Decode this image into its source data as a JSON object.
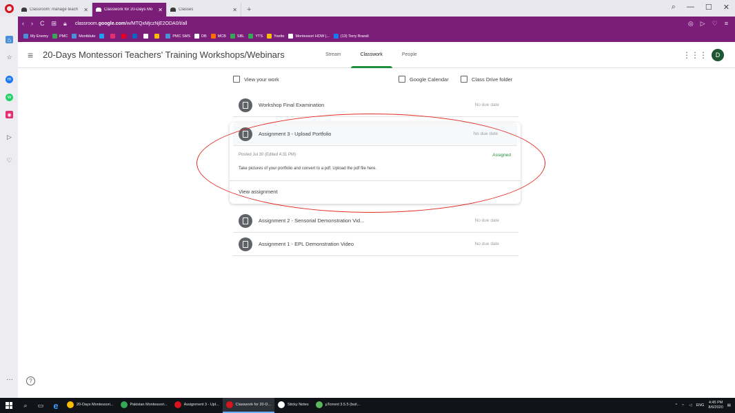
{
  "browser": {
    "tabs": [
      {
        "title": "Classroom: manage teach",
        "active": false
      },
      {
        "title": "Classwork for 20-Days Mo",
        "active": true
      },
      {
        "title": "Classes",
        "active": false
      }
    ],
    "new_tab": "+",
    "url_prefix": "classroom.",
    "url_domain": "google.com",
    "url_path": "/w/MTQxMjczNjE2ODA0/t/all",
    "window_controls": [
      "⌕",
      "—",
      "☐",
      "✕"
    ],
    "bookmarks": [
      {
        "label": "My Enemy",
        "color": "#4a90d9"
      },
      {
        "label": "PMC",
        "color": "#3aa757"
      },
      {
        "label": "Montblute",
        "color": "#4a90d9"
      },
      {
        "label": "",
        "color": "#1da1f2"
      },
      {
        "label": "",
        "color": "#e1306c"
      },
      {
        "label": "",
        "color": "#e60023"
      },
      {
        "label": "",
        "color": "#0a66c2"
      },
      {
        "label": "",
        "color": "#ffffff"
      },
      {
        "label": "",
        "color": "#fbbc04"
      },
      {
        "label": "PMC SMS",
        "color": "#4a90d9"
      },
      {
        "label": "DB",
        "color": "#ffffff"
      },
      {
        "label": "MCB",
        "color": "#ff6d00"
      },
      {
        "label": "SBL",
        "color": "#34a853"
      },
      {
        "label": "YTS",
        "color": "#34a853"
      },
      {
        "label": "Yoette",
        "color": "#fbbc04"
      },
      {
        "label": "Montessori HOW |...",
        "color": "#ffffff"
      },
      {
        "label": "(13) Terry Brandi",
        "color": "#1877f2"
      }
    ]
  },
  "classroom": {
    "course_title": "20-Days Montessori Teachers' Training Workshops/Webinars",
    "tabs": [
      "Stream",
      "Classwork",
      "People"
    ],
    "active_tab": "Classwork",
    "avatar_letter": "D",
    "view_your_work": "View your work",
    "google_calendar": "Google Calendar",
    "class_drive_folder": "Class Drive folder",
    "items": [
      {
        "title": "Workshop Final Examination",
        "due": "No due date"
      },
      {
        "title": "Assignment 3 - Upload Portfolio",
        "due": "No due date"
      },
      {
        "title": "Assignment 2 - Sensorial Demonstration Vid...",
        "due": "No due date"
      },
      {
        "title": "Assignment 1 - EPL Demonstration Video",
        "due": "No due date"
      }
    ],
    "expanded": {
      "posted": "Posted Jul 30 (Edited 4:31 PM)",
      "status": "Assigned",
      "instructions": "Take pictures of your portfolio and convert to a pdf. Upload the pdf file here.",
      "view_link": "View assignment"
    },
    "help": "?"
  },
  "taskbar": {
    "items": [
      {
        "label": "20-Days Montessori...",
        "color": "#fbbc04",
        "active": false
      },
      {
        "label": "Pakistan Montessori...",
        "color": "#34a853",
        "active": false
      },
      {
        "label": "Assignment 3 - Upl...",
        "color": "#d7141e",
        "active": false
      },
      {
        "label": "Classwork for 20-D...",
        "color": "#d7141e",
        "active": true
      },
      {
        "label": "Sticky Notes",
        "color": "#ffffff",
        "active": false
      },
      {
        "label": "µTorrent 3.5.5 (buil...",
        "color": "#5cb85c",
        "active": false
      }
    ],
    "lang": "ENG",
    "time": "4:45 PM",
    "date": "8/6/2020"
  }
}
